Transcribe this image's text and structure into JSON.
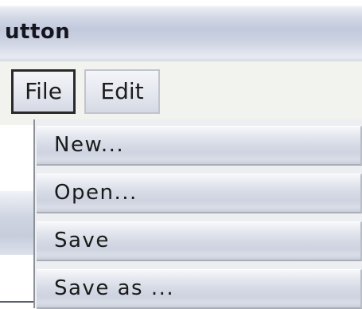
{
  "window": {
    "title": "utton"
  },
  "menubar": {
    "items": [
      {
        "label": "File"
      },
      {
        "label": "Edit"
      }
    ]
  },
  "dropdown": {
    "items": [
      {
        "label": "New..."
      },
      {
        "label": "Open..."
      },
      {
        "label": "Save"
      },
      {
        "label": "Save as ..."
      }
    ]
  }
}
